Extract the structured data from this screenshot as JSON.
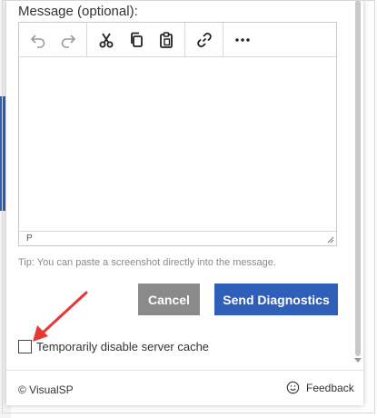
{
  "dialog": {
    "message_label": "Message (optional):",
    "status_path": "P",
    "tip": "Tip: You can paste a screenshot directly into the message.",
    "cancel_label": "Cancel",
    "send_label": "Send Diagnostics",
    "cache_checkbox_label": "Temporarily disable server cache",
    "cache_checked": false
  },
  "toolbar": {
    "groups": [
      [
        "undo-icon",
        "redo-icon"
      ],
      [
        "cut-icon",
        "copy-icon",
        "paste-icon"
      ],
      [
        "link-icon"
      ],
      [
        "more-icon"
      ]
    ]
  },
  "footer": {
    "copyright": "© VisualSP",
    "feedback_label": "Feedback"
  },
  "colors": {
    "primary": "#2f5fb8",
    "cancel": "#8a8a8a",
    "annotation_arrow": "#e53935"
  }
}
